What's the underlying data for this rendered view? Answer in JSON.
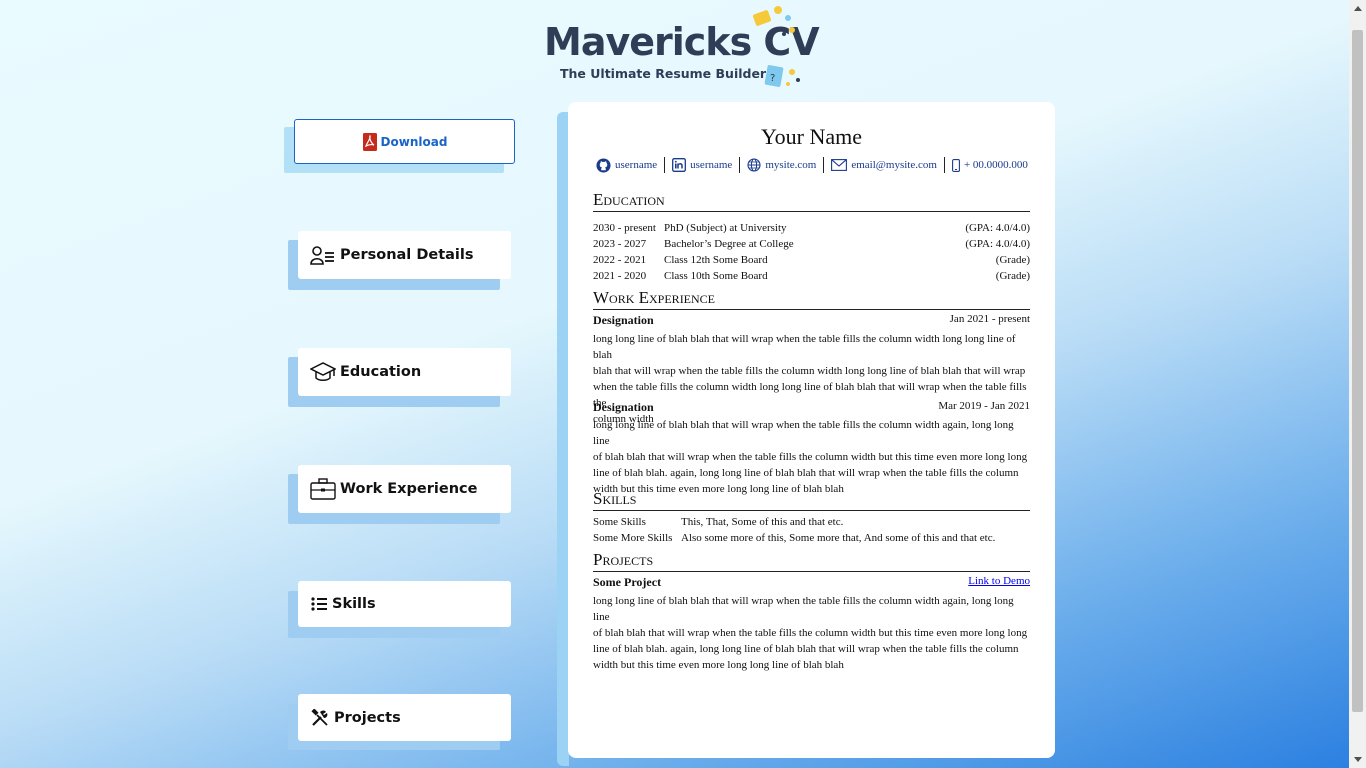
{
  "logo": {
    "title": "Mavericks CV",
    "subtitle": "The Ultimate Resume Builder"
  },
  "nav": {
    "download_label": "Download",
    "items": [
      {
        "label": "Personal Details",
        "icon": "personal-details-icon"
      },
      {
        "label": "Education",
        "icon": "graduation-cap-icon"
      },
      {
        "label": "Work Experience",
        "icon": "briefcase-icon"
      },
      {
        "label": "Skills",
        "icon": "list-icon"
      },
      {
        "label": "Projects",
        "icon": "tools-icon"
      }
    ]
  },
  "resume": {
    "name": "Your Name",
    "contacts": [
      {
        "icon": "github-icon",
        "text": "username"
      },
      {
        "icon": "linkedin-icon",
        "text": "username"
      },
      {
        "icon": "globe-icon",
        "text": "mysite.com"
      },
      {
        "icon": "email-icon",
        "text": "email@mysite.com"
      },
      {
        "icon": "phone-icon",
        "text": "+ 00.0000.000"
      }
    ],
    "education": {
      "title": "Education",
      "rows": [
        {
          "years": "2030 - present",
          "degree": "PhD (Subject) at University",
          "grade": "(GPA: 4.0/4.0)"
        },
        {
          "years": "2023 - 2027",
          "degree": "Bachelor’s Degree at College",
          "grade": "(GPA: 4.0/4.0)"
        },
        {
          "years": "2022 - 2021",
          "degree": "Class 12th Some Board",
          "grade": "(Grade)"
        },
        {
          "years": "2021 - 2020",
          "degree": "Class 10th Some Board",
          "grade": "(Grade)"
        }
      ]
    },
    "work": {
      "title": "Work Experience",
      "jobs": [
        {
          "designation": "Designation",
          "dates": "Jan 2021 - present",
          "lines": [
            "long long line of blah blah that will wrap when the table fills the column width long long line of blah",
            "blah that will wrap when the table fills the column width long long line of blah blah that will wrap",
            "when the table fills the column width long long line of blah blah that will wrap when the table fills the",
            "column width"
          ]
        },
        {
          "designation": "Designation",
          "dates": "Mar 2019 - Jan 2021",
          "lines": [
            "long long line of blah blah that will wrap when the table fills the column width again, long long line",
            "of blah blah that will wrap when the table fills the column width but this time even more long long",
            "line of blah blah. again, long long line of blah blah that will wrap when the table fills the column",
            "width but this time even more long long line of blah blah"
          ]
        }
      ]
    },
    "skills": {
      "title": "Skills",
      "rows": [
        {
          "name": "Some Skills",
          "value": "This, That, Some of this and that etc."
        },
        {
          "name": "Some More Skills",
          "value": "Also some more of this, Some more that, And some of this and that etc."
        }
      ]
    },
    "projects": {
      "title": "Projects",
      "items": [
        {
          "name": "Some Project",
          "link": "Link to Demo",
          "lines": [
            "long long line of blah blah that will wrap when the table fills the column width again, long long line",
            "of blah blah that will wrap when the table fills the column width but this time even more long long",
            "line of blah blah. again, long long line of blah blah that will wrap when the table fills the column",
            "width but this time even more long long line of blah blah"
          ]
        }
      ]
    }
  }
}
